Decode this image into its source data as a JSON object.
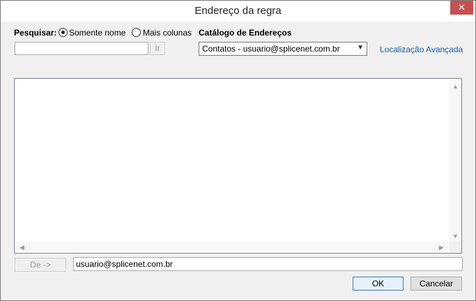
{
  "window": {
    "title": "Endereço da regra",
    "close_glyph": "✕"
  },
  "search": {
    "label": "Pesquisar:",
    "options": [
      {
        "label": "Somente nome",
        "selected": true
      },
      {
        "label": "Mais colunas",
        "selected": false
      }
    ],
    "input_value": "",
    "go_label": "Ir"
  },
  "address_book": {
    "label": "Catálogo de Endereços",
    "selected": "Contatos - usuario@splicenet.com.br",
    "advanced_link": "Localização Avançada"
  },
  "results_list": {
    "items": []
  },
  "from": {
    "button_label": "De ->",
    "value": "usuario@splicenet.com.br"
  },
  "footer": {
    "ok_label": "OK",
    "cancel_label": "Cancelar"
  },
  "icons": {
    "dropdown": "chevron-down-icon",
    "close": "close-icon"
  }
}
